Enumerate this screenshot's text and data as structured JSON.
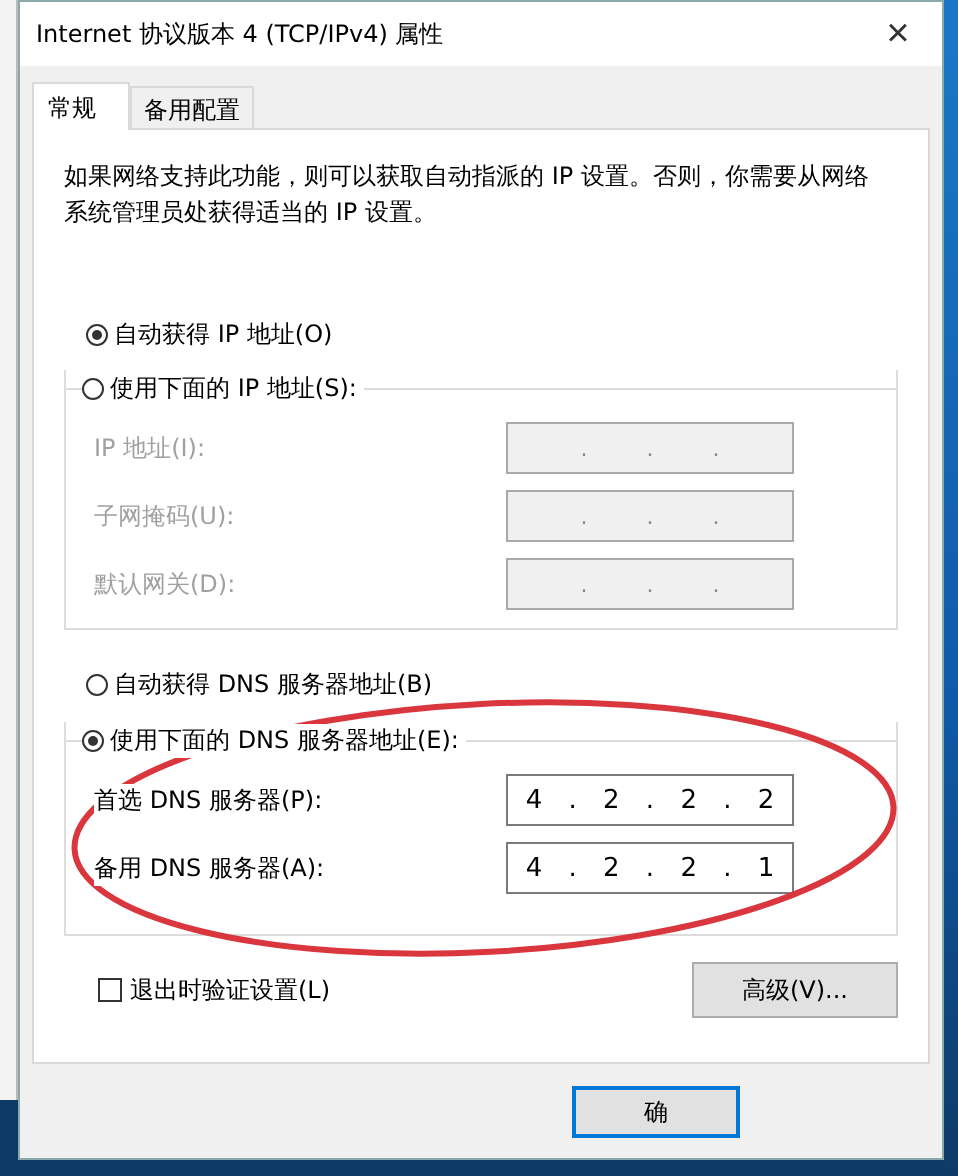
{
  "window": {
    "title": "Internet 协议版本 4 (TCP/IPv4) 属性",
    "close": "×"
  },
  "tabs": [
    {
      "label": "常规",
      "selected": true
    },
    {
      "label": "备用配置",
      "selected": false
    }
  ],
  "description": "如果网络支持此功能，则可以获取自动指派的 IP 设置。否则，你需要从网络系统管理员处获得适当的 IP 设置。",
  "ip_mode": [
    {
      "label": "自动获得 IP 地址(O)",
      "selected": true
    },
    {
      "label": "使用下面的 IP 地址(S):",
      "selected": false
    }
  ],
  "ip_fields": [
    {
      "label": "IP 地址(I):",
      "value": ". . .",
      "disabled": true
    },
    {
      "label": "子网掩码(U):",
      "value": ". . .",
      "disabled": true
    },
    {
      "label": "默认网关(D):",
      "value": ". . .",
      "disabled": true
    }
  ],
  "dns_mode": [
    {
      "label": "自动获得 DNS 服务器地址(B)",
      "selected": false
    },
    {
      "label": "使用下面的 DNS 服务器地址(E):",
      "selected": true
    }
  ],
  "dns_fields": [
    {
      "label": "首选 DNS 服务器(P):",
      "value": "4 . 2 . 2 . 2",
      "disabled": false
    },
    {
      "label": "备用 DNS 服务器(A):",
      "value": "4 . 2 . 2 . 1",
      "disabled": false
    }
  ],
  "validate": {
    "label": "退出时验证设置(L)",
    "checked": false
  },
  "advanced_button": "高级(V)...",
  "ok_button": "确"
}
